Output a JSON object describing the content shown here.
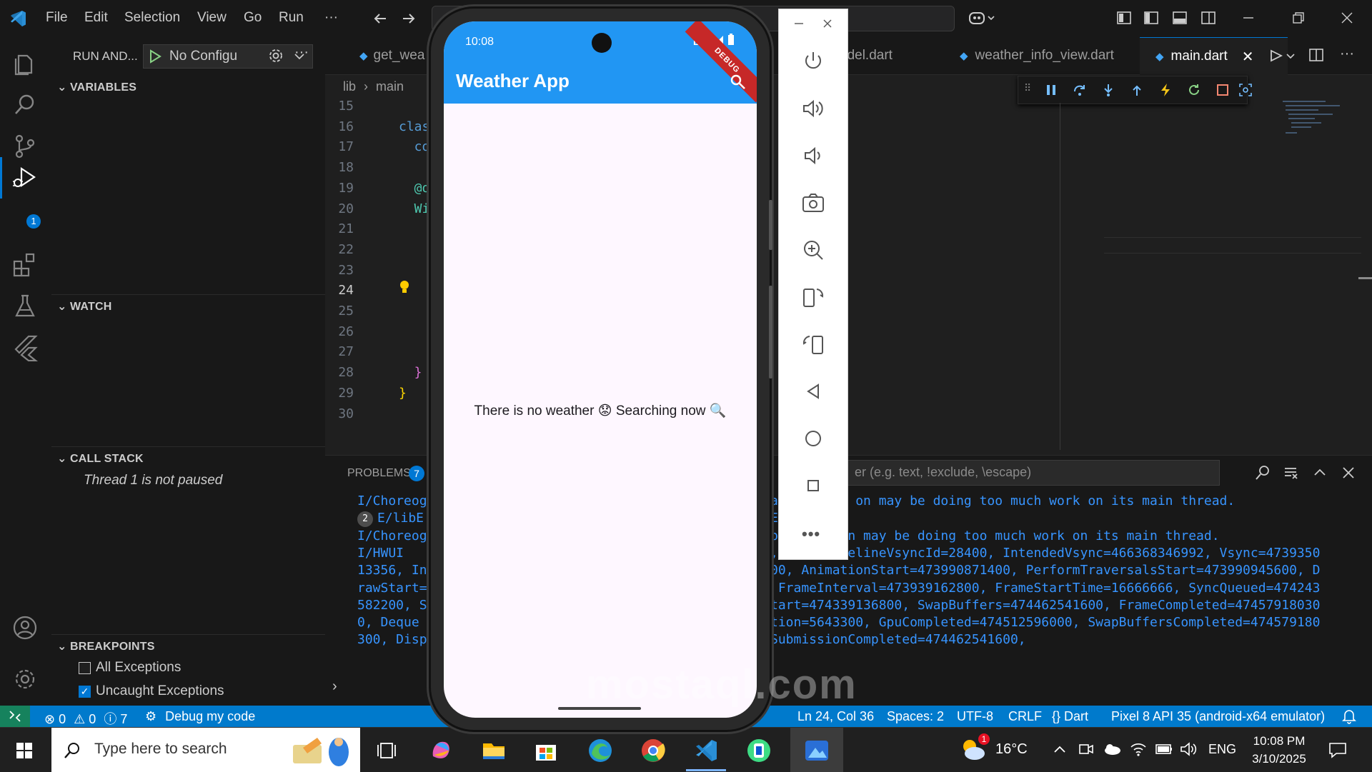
{
  "menu": [
    "File",
    "Edit",
    "Selection",
    "View",
    "Go",
    "Run",
    "···"
  ],
  "activity": {
    "debug_badge": "1"
  },
  "run_panel": {
    "title": "RUN AND...",
    "config": "No Configu",
    "sections": {
      "variables": "VARIABLES",
      "watch": "WATCH",
      "call_stack": "CALL STACK",
      "breakpoints": "BREAKPOINTS"
    },
    "call_stack_msg": "Thread 1 is not paused",
    "breakpoints": [
      {
        "label": "All Exceptions",
        "checked": false
      },
      {
        "label": "Uncaught Exceptions",
        "checked": true
      }
    ]
  },
  "tabs": [
    {
      "label": "get_wea",
      "active": false
    },
    {
      "label": "odel.dart",
      "active": false
    },
    {
      "label": "weather_info_view.dart",
      "active": false
    },
    {
      "label": "main.dart",
      "active": true
    }
  ],
  "breadcrumb": [
    "lib",
    "main"
  ],
  "code_lines": [
    {
      "n": "15",
      "t": ""
    },
    {
      "n": "16",
      "t": "clas"
    },
    {
      "n": "17",
      "t": "  co"
    },
    {
      "n": "18",
      "t": ""
    },
    {
      "n": "19",
      "t": "  @o"
    },
    {
      "n": "20",
      "t": "  Wi"
    },
    {
      "n": "21",
      "t": ""
    },
    {
      "n": "22",
      "t": ""
    },
    {
      "n": "23",
      "t": ""
    },
    {
      "n": "24",
      "t": ""
    },
    {
      "n": "25",
      "t": ""
    },
    {
      "n": "26",
      "t": ""
    },
    {
      "n": "27",
      "t": ""
    },
    {
      "n": "28",
      "t": "  }"
    },
    {
      "n": "29",
      "t": "}"
    },
    {
      "n": "30",
      "t": ""
    }
  ],
  "panel": {
    "problems_label": "PROBLEMS",
    "problems_count": "7",
    "filter_placeholder": "er (e.g. text, !exclude, \\escape)",
    "left_lines": [
      "I/Choreog",
      "E/libE",
      "I/Choreog",
      "I/HWUI",
      "13356, In",
      "rawStart=",
      "582200, S",
      "0, Deque",
      "300, Disp"
    ],
    "repeat_badge": "2",
    "right_lines": [
      "a          on may be doing too much work on its main thread.",
      "E",
      "p         n may be doing too much work on its main thread.",
      ", FrameTimelineVsyncId=28400, IntendedVsync=466368346992, Vsync=4739350",
      "00, AnimationStart=473990871400, PerformTraversalsStart=473990945600, D",
      " FrameInterval=473939162800, FrameStartTime=16666666, SyncQueued=474243",
      "tart=474339136800, SwapBuffers=474462541600, FrameCompleted=47457918030",
      "tion=5643300, GpuCompleted=474512596000, SwapBuffersCompleted=474579180",
      "SubmissionCompleted=474462541600,"
    ]
  },
  "status": {
    "errors": "0",
    "warnings": "0",
    "infos": "7",
    "debug": "Debug my code",
    "position": "Ln 24, Col 36",
    "spaces": "Spaces: 2",
    "encoding": "UTF-8",
    "eol": "CRLF",
    "language": "Dart",
    "device": "Pixel 8 API 35 (android-x64 emulator)"
  },
  "phone": {
    "time": "10:08",
    "network": "LTE",
    "debug_banner": "DEBUG",
    "app_title": "Weather App",
    "message": "There is no weather 😟 Searching now 🔍"
  },
  "taskbar": {
    "search_placeholder": "Type here to search",
    "weather": "16°C",
    "weather_badge": "1",
    "language": "ENG",
    "time": "10:08 PM",
    "date": "3/10/2025"
  },
  "watermark": "mostaql.com",
  "colors": {
    "accent": "#007acc",
    "appbar": "#2196f3",
    "terminal_text": "#3794ff"
  }
}
